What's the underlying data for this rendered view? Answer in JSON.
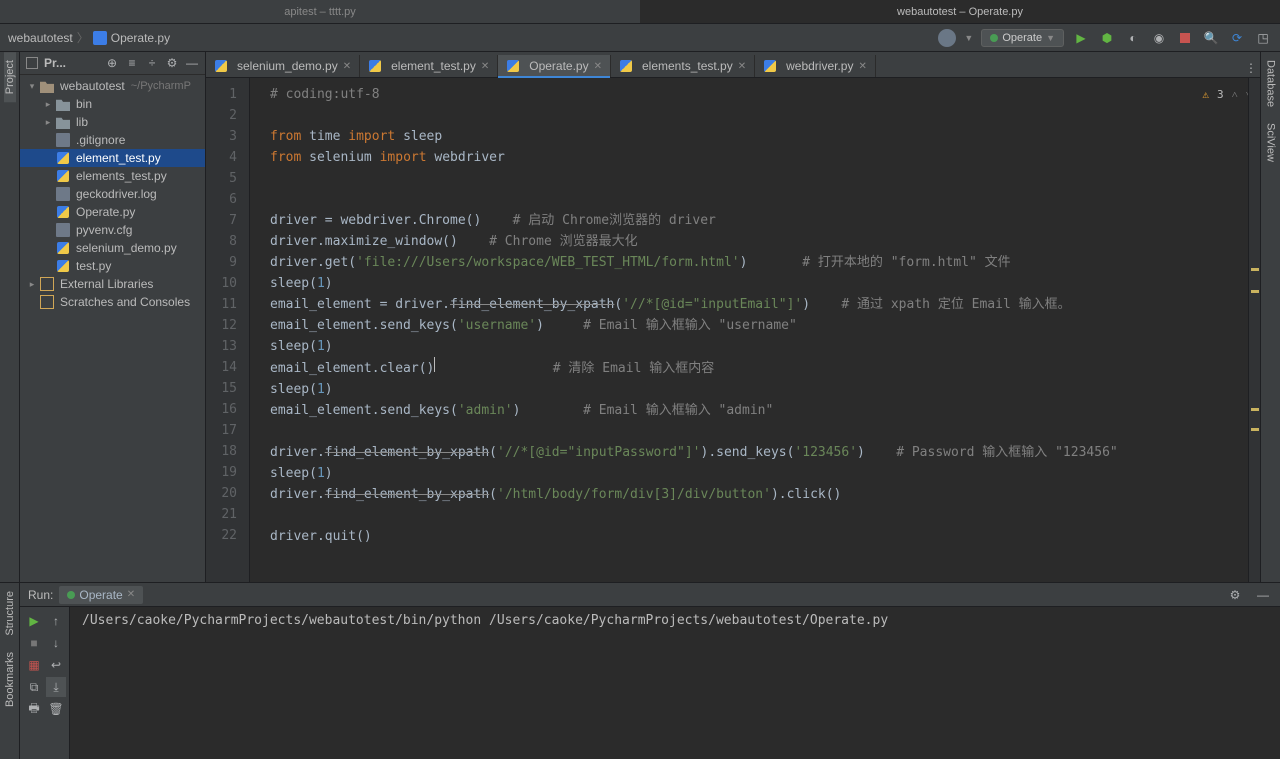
{
  "topTabs": [
    {
      "label": "apitest – tttt.py",
      "active": false
    },
    {
      "label": "webautotest – Operate.py",
      "active": true
    }
  ],
  "breadcrumb": {
    "root": "webautotest",
    "file": "Operate.py"
  },
  "runConfig": "Operate",
  "inspections": {
    "warnings": "3"
  },
  "projectPane": {
    "title": "Pr...",
    "hintRoot": "~/PycharmP"
  },
  "tree": [
    {
      "depth": 0,
      "tw": "▾",
      "icon": "folder-root",
      "label": "webautotest",
      "hint": "~/PycharmP"
    },
    {
      "depth": 1,
      "tw": "▸",
      "icon": "folder",
      "label": "bin"
    },
    {
      "depth": 1,
      "tw": "▸",
      "icon": "folder",
      "label": "lib"
    },
    {
      "depth": 1,
      "tw": "",
      "icon": "txt",
      "label": ".gitignore"
    },
    {
      "depth": 1,
      "tw": "",
      "icon": "py",
      "label": "element_test.py",
      "sel": true
    },
    {
      "depth": 1,
      "tw": "",
      "icon": "py",
      "label": "elements_test.py"
    },
    {
      "depth": 1,
      "tw": "",
      "icon": "txt",
      "label": "geckodriver.log"
    },
    {
      "depth": 1,
      "tw": "",
      "icon": "py",
      "label": "Operate.py"
    },
    {
      "depth": 1,
      "tw": "",
      "icon": "txt",
      "label": "pyvenv.cfg"
    },
    {
      "depth": 1,
      "tw": "",
      "icon": "py",
      "label": "selenium_demo.py"
    },
    {
      "depth": 1,
      "tw": "",
      "icon": "py",
      "label": "test.py"
    },
    {
      "depth": 0,
      "tw": "▸",
      "icon": "ext",
      "label": "External Libraries"
    },
    {
      "depth": 0,
      "tw": "",
      "icon": "ext",
      "label": "Scratches and Consoles"
    }
  ],
  "editorTabs": [
    {
      "label": "selenium_demo.py",
      "active": false
    },
    {
      "label": "element_test.py",
      "active": false
    },
    {
      "label": "Operate.py",
      "active": true
    },
    {
      "label": "elements_test.py",
      "active": false
    },
    {
      "label": "webdriver.py",
      "active": false
    }
  ],
  "code": [
    {
      "n": 1,
      "seg": [
        {
          "t": "# coding:utf-8",
          "c": "com"
        }
      ]
    },
    {
      "n": 2,
      "seg": []
    },
    {
      "n": 3,
      "seg": [
        {
          "t": "from",
          "c": "kw"
        },
        {
          "t": " time "
        },
        {
          "t": "import",
          "c": "kw"
        },
        {
          "t": " sleep"
        }
      ]
    },
    {
      "n": 4,
      "seg": [
        {
          "t": "from",
          "c": "kw"
        },
        {
          "t": " selenium "
        },
        {
          "t": "import",
          "c": "kw"
        },
        {
          "t": " webdriver"
        }
      ]
    },
    {
      "n": 5,
      "seg": []
    },
    {
      "n": 6,
      "seg": []
    },
    {
      "n": 7,
      "seg": [
        {
          "t": "driver = webdriver.Chrome()    "
        },
        {
          "t": "# 启动 Chrome浏览器的 driver",
          "c": "com"
        }
      ]
    },
    {
      "n": 8,
      "seg": [
        {
          "t": "driver.maximize_window()    "
        },
        {
          "t": "# Chrome 浏览器最大化",
          "c": "com"
        }
      ]
    },
    {
      "n": 9,
      "seg": [
        {
          "t": "driver.get("
        },
        {
          "t": "'file:///Users/workspace/WEB_TEST_HTML/form.html'",
          "c": "str"
        },
        {
          "t": ")       "
        },
        {
          "t": "# 打开本地的 \"form.html\" 文件",
          "c": "com"
        }
      ]
    },
    {
      "n": 10,
      "seg": [
        {
          "t": "sleep("
        },
        {
          "t": "1",
          "c": "num"
        },
        {
          "t": ")"
        }
      ]
    },
    {
      "n": 11,
      "seg": [
        {
          "t": "email_element = driver."
        },
        {
          "t": "find_element_by_xpath",
          "c": "strike"
        },
        {
          "t": "("
        },
        {
          "t": "'//*[@id=\"inputEmail\"]'",
          "c": "str"
        },
        {
          "t": ")    "
        },
        {
          "t": "# 通过 xpath 定位 Email 输入框。",
          "c": "com"
        }
      ]
    },
    {
      "n": 12,
      "seg": [
        {
          "t": "email_element.send_keys("
        },
        {
          "t": "'username'",
          "c": "str"
        },
        {
          "t": ")     "
        },
        {
          "t": "# Email 输入框输入 \"username\"",
          "c": "com"
        }
      ]
    },
    {
      "n": 13,
      "seg": [
        {
          "t": "sleep("
        },
        {
          "t": "1",
          "c": "num"
        },
        {
          "t": ")"
        }
      ]
    },
    {
      "n": 14,
      "seg": [
        {
          "t": "email_element.clear()"
        },
        {
          "t": "               "
        },
        {
          "t": "# 清除 Email 输入框内容",
          "c": "com"
        }
      ],
      "cursor": true
    },
    {
      "n": 15,
      "seg": [
        {
          "t": "sleep("
        },
        {
          "t": "1",
          "c": "num"
        },
        {
          "t": ")"
        }
      ]
    },
    {
      "n": 16,
      "seg": [
        {
          "t": "email_element.send_keys("
        },
        {
          "t": "'admin'",
          "c": "str"
        },
        {
          "t": ")        "
        },
        {
          "t": "# Email 输入框输入 \"admin\"",
          "c": "com"
        }
      ]
    },
    {
      "n": 17,
      "seg": []
    },
    {
      "n": 18,
      "seg": [
        {
          "t": "driver."
        },
        {
          "t": "find_element_by_xpath",
          "c": "strike"
        },
        {
          "t": "("
        },
        {
          "t": "'//*[@id=\"inputPassword\"]'",
          "c": "str"
        },
        {
          "t": ").send_keys("
        },
        {
          "t": "'123456'",
          "c": "str"
        },
        {
          "t": ")    "
        },
        {
          "t": "# Password 输入框输入 \"123456\"",
          "c": "com"
        }
      ]
    },
    {
      "n": 19,
      "seg": [
        {
          "t": "sleep("
        },
        {
          "t": "1",
          "c": "num"
        },
        {
          "t": ")"
        }
      ]
    },
    {
      "n": 20,
      "seg": [
        {
          "t": "driver."
        },
        {
          "t": "find_element_by_xpath",
          "c": "strike"
        },
        {
          "t": "("
        },
        {
          "t": "'/html/body/form/div[3]/div/button'",
          "c": "str"
        },
        {
          "t": ").click()"
        }
      ]
    },
    {
      "n": 21,
      "seg": []
    },
    {
      "n": 22,
      "seg": [
        {
          "t": "driver.quit()"
        }
      ]
    }
  ],
  "sideLabels": {
    "project": "Project",
    "structure": "Structure",
    "bookmarks": "Bookmarks",
    "database": "Database",
    "sciview": "SciView"
  },
  "runPanel": {
    "title": "Run:",
    "tab": "Operate",
    "output": "/Users/caoke/PycharmProjects/webautotest/bin/python /Users/caoke/PycharmProjects/webautotest/Operate.py"
  }
}
